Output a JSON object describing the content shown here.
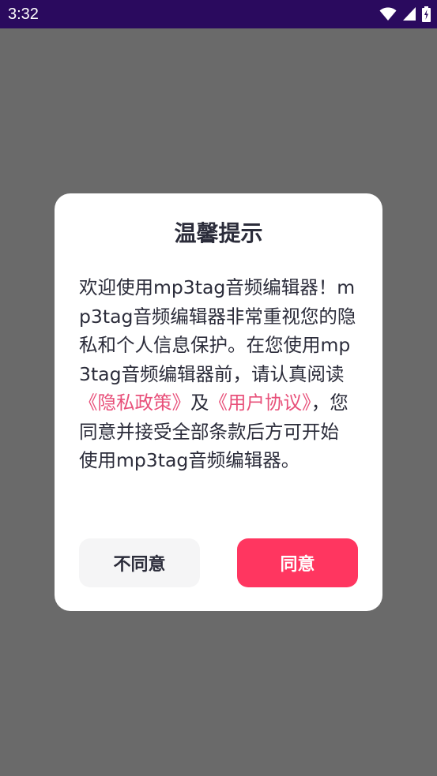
{
  "status_bar": {
    "time": "3:32",
    "icons": [
      "wifi-icon",
      "signal-icon",
      "battery-icon"
    ],
    "background": "#2a0a5e"
  },
  "dialog": {
    "title": "温馨提示",
    "body_parts": {
      "p1": "欢迎使用mp3tag音频编辑器！mp3tag音频编辑器非常重视您的隐私和个人信息保护。在您使用mp3tag音频编辑器前，请认真阅读",
      "privacy_link": "《隐私政策》",
      "and": "及",
      "agreement_link": "《用户协议》",
      "p2": "，您同意并接受全部条款后方可开始使用mp3tag音频编辑器。"
    },
    "disagree_label": "不同意",
    "agree_label": "同意",
    "link_color": "#e8507a",
    "agree_color": "#ff3660"
  }
}
